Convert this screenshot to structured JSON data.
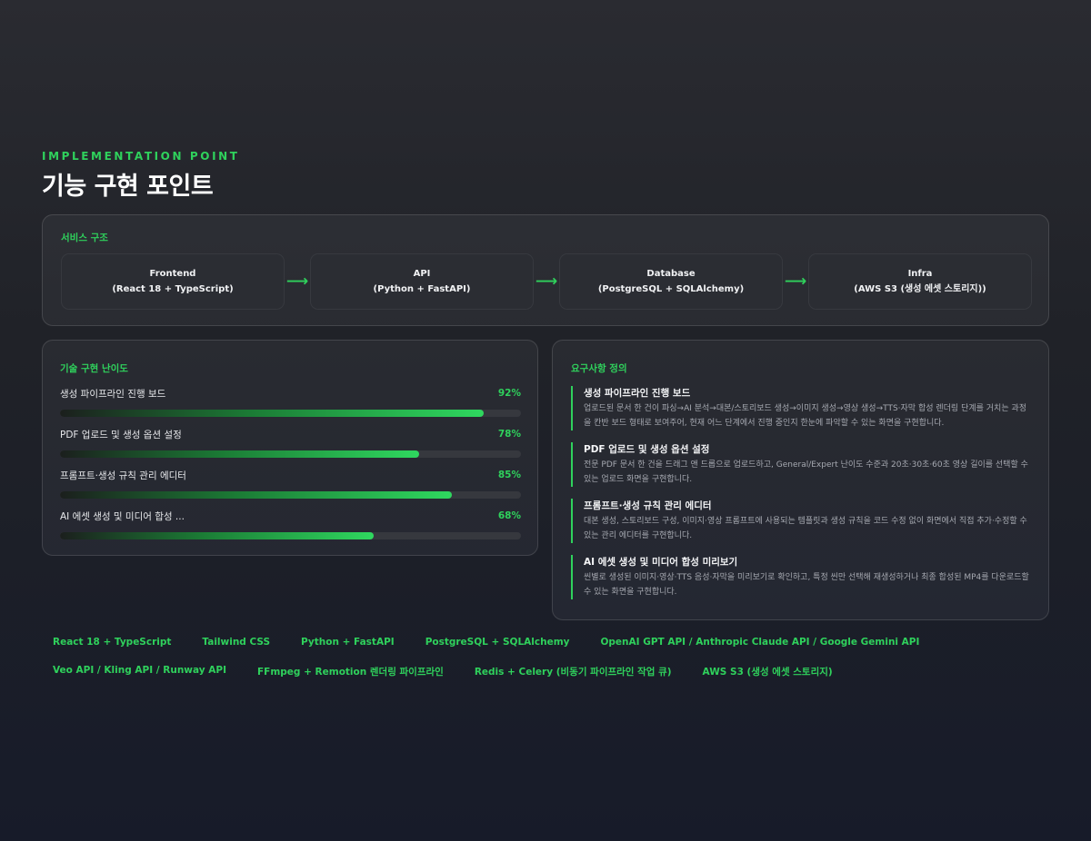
{
  "header": {
    "eyebrow": "IMPLEMENTATION POINT",
    "title": "기능 구현 포인트"
  },
  "structure": {
    "label": "서비스 구조",
    "arrow": "⟶",
    "nodes": [
      {
        "name": "Frontend",
        "detail": "(React 18 + TypeScript)"
      },
      {
        "name": "API",
        "detail": "(Python + FastAPI)"
      },
      {
        "name": "Database",
        "detail": "(PostgreSQL + SQLAlchemy)"
      },
      {
        "name": "Infra",
        "detail": "(AWS S3 (생성 에셋 스토리지))"
      }
    ]
  },
  "difficulty": {
    "label": "기술 구현 난이도",
    "items": [
      {
        "name": "생성 파이프라인 진행 보드",
        "percent_label": "92%",
        "percent": 92
      },
      {
        "name": "PDF 업로드 및 생성 옵션 설정",
        "percent_label": "78%",
        "percent": 78
      },
      {
        "name": "프롬프트·생성 규칙 관리 에디터",
        "percent_label": "85%",
        "percent": 85
      },
      {
        "name": "AI 에셋 생성 및 미디어 합성 ...",
        "percent_label": "68%",
        "percent": 68
      }
    ]
  },
  "requirements": {
    "label": "요구사항 정의",
    "items": [
      {
        "title": "생성 파이프라인 진행 보드",
        "desc": "업로드된 문서 한 건이 파싱→AI 분석→대본/스토리보드 생성→이미지 생성→영상 생성→TTS·자막 합성 렌더링 단계를 거치는 과정을 칸반 보드 형태로 보여주어, 현재 어느 단계에서 진행 중인지 한눈에 파악할 수 있는 화면을 구현합니다."
      },
      {
        "title": "PDF 업로드 및 생성 옵션 설정",
        "desc": "전문 PDF 문서 한 건을 드래그 앤 드롭으로 업로드하고, General/Expert 난이도 수준과 20초·30초·60초 영상 길이를 선택할 수 있는 업로드 화면을 구현합니다."
      },
      {
        "title": "프롬프트·생성 규칙 관리 에디터",
        "desc": "대본 생성, 스토리보드 구성, 이미지·영상 프롬프트에 사용되는 템플릿과 생성 규칙을 코드 수정 없이 화면에서 직접 추가·수정할 수 있는 관리 에디터를 구현합니다."
      },
      {
        "title": "AI 에셋 생성 및 미디어 합성 미리보기",
        "desc": "씬별로 생성된 이미지·영상·TTS 음성·자막을 미리보기로 확인하고, 특정 씬만 선택해 재생성하거나 최종 합성된 MP4를 다운로드할 수 있는 화면을 구현합니다."
      }
    ]
  },
  "tags": [
    "React 18 + TypeScript",
    "Tailwind CSS",
    "Python + FastAPI",
    "PostgreSQL + SQLAlchemy",
    "OpenAI GPT API / Anthropic Claude API / Google Gemini API",
    "Veo API / Kling API / Runway API",
    "FFmpeg + Remotion 렌더링 파이프라인",
    "Redis + Celery (비동기 파이프라인 작업 큐)",
    "AWS S3 (생성 에셋 스토리지)"
  ]
}
